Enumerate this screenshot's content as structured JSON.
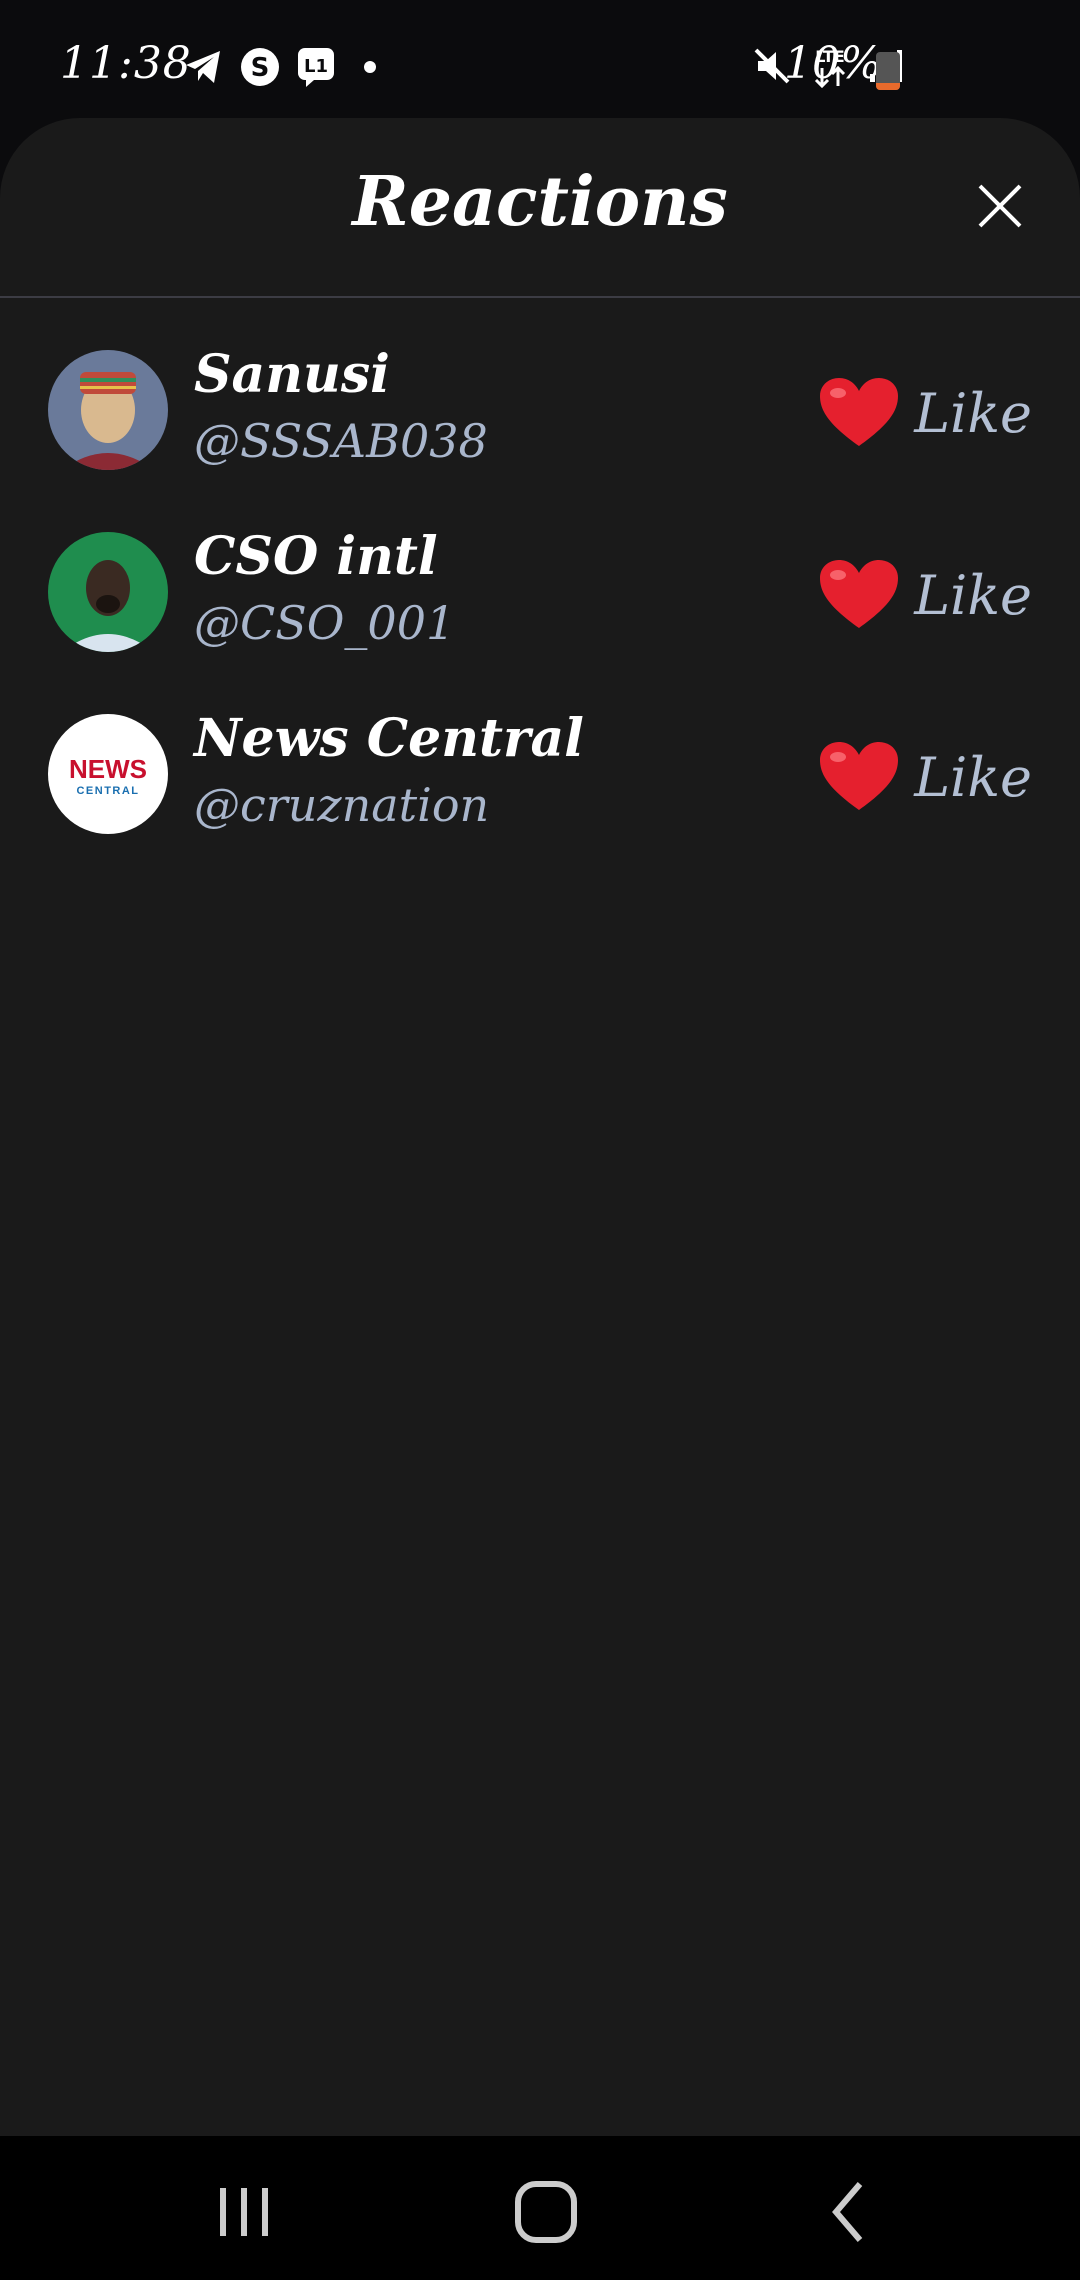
{
  "status_bar": {
    "time": "11:38",
    "battery_percent": "10%",
    "battery_level": 0.1,
    "network_label": "LTE",
    "icons_left": [
      "telegram-icon",
      "threads-icon",
      "chat-icon",
      "dot-icon"
    ],
    "icons_right": [
      "mute-icon",
      "lte-icon",
      "signal-icon",
      "battery-icon"
    ]
  },
  "sheet": {
    "title": "Reactions",
    "close_icon": "close-icon"
  },
  "reactions": [
    {
      "name": "Sanusi",
      "handle": "@SSSAB038",
      "reaction_label": "Like",
      "reaction_icon": "heart-icon",
      "avatar_colors": [
        "#6a7a9a",
        "#d9b98f",
        "#8b2a34"
      ]
    },
    {
      "name": "CSO intl",
      "handle": "@CSO_001",
      "reaction_label": "Like",
      "reaction_icon": "heart-icon",
      "avatar_colors": [
        "#1f8d4e",
        "#3a2a22",
        "#d8e4ef"
      ]
    },
    {
      "name": "News Central",
      "handle": "@cruznation",
      "reaction_label": "Like",
      "reaction_icon": "heart-icon",
      "avatar_logo": "NEWS",
      "avatar_logo_sub": "CENTRAL",
      "avatar_colors": [
        "#ffffff",
        "#c8102e",
        "#1a6fb0"
      ]
    }
  ],
  "nav_bar": {
    "buttons": [
      "recents-icon",
      "home-icon",
      "back-icon"
    ]
  },
  "colors": {
    "sheet_bg": "#1a1a1a",
    "heart": "#e5202e",
    "handle": "#a9b6cc"
  }
}
